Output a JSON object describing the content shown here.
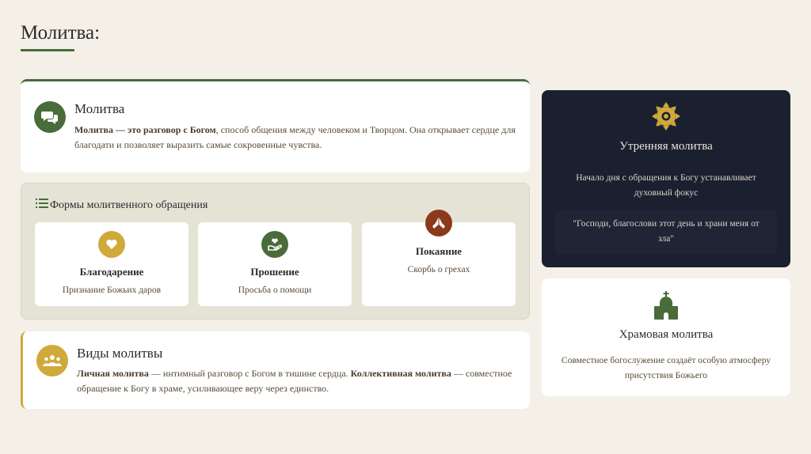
{
  "page": {
    "title": "Молитва:"
  },
  "prayer_card": {
    "heading": "Молитва",
    "bold_lead": "Молитва — это разговор с Богом",
    "text": ", способ общения между человеком и Творцом. Она открывает сердце для благодати и позволяет выразить самые сокровенные чувства.",
    "icon": "chat-bubbles-icon"
  },
  "forms": {
    "heading": "Формы молитвенного обращения",
    "icon": "list-icon",
    "items": [
      {
        "title": "Благодарение",
        "subtitle": "Признание Божьих даров",
        "icon": "heart-icon"
      },
      {
        "title": "Прошение",
        "subtitle": "Просьба о помощи",
        "icon": "hand-heart-icon"
      },
      {
        "title": "Покаяние",
        "subtitle": "Скорбь о грехах",
        "icon": "praying-hands-icon"
      }
    ]
  },
  "types_card": {
    "heading": "Виды молитвы",
    "bold_1": "Личная молитва",
    "text_1": " — интимный разговор с Богом в тишине сердца. ",
    "bold_2": "Коллективная молитва",
    "text_2": " — совместное обращение к Богу в храме, усиливающее веру через единство.",
    "icon": "people-group-icon"
  },
  "morning_card": {
    "heading": "Утренняя молитва",
    "text": "Начало дня с обращения к Богу устанавливает духовный фокус",
    "quote": "\"Господи, благослови этот день и храни меня от зла\"",
    "icon": "sun-icon"
  },
  "temple_card": {
    "heading": "Храмовая молитва",
    "text": "Совместное богослужение создаёт особую атмосферу присутствия Божьего",
    "icon": "church-icon"
  },
  "colors": {
    "green": "#4a6b3a",
    "gold": "#cfa93a",
    "rust": "#8a3a1a",
    "navy": "#1b2030",
    "background": "#f4f0e8"
  }
}
